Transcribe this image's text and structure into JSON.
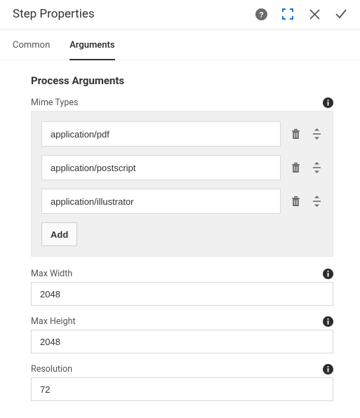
{
  "header": {
    "title": "Step Properties"
  },
  "tabs": {
    "common": "Common",
    "arguments": "Arguments"
  },
  "section": {
    "title": "Process Arguments"
  },
  "mimeTypes": {
    "label": "Mime Types",
    "items": [
      "application/pdf",
      "application/postscript",
      "application/illustrator"
    ],
    "addLabel": "Add"
  },
  "maxWidth": {
    "label": "Max Width",
    "value": "2048"
  },
  "maxHeight": {
    "label": "Max Height",
    "value": "2048"
  },
  "resolution": {
    "label": "Resolution",
    "value": "72"
  }
}
